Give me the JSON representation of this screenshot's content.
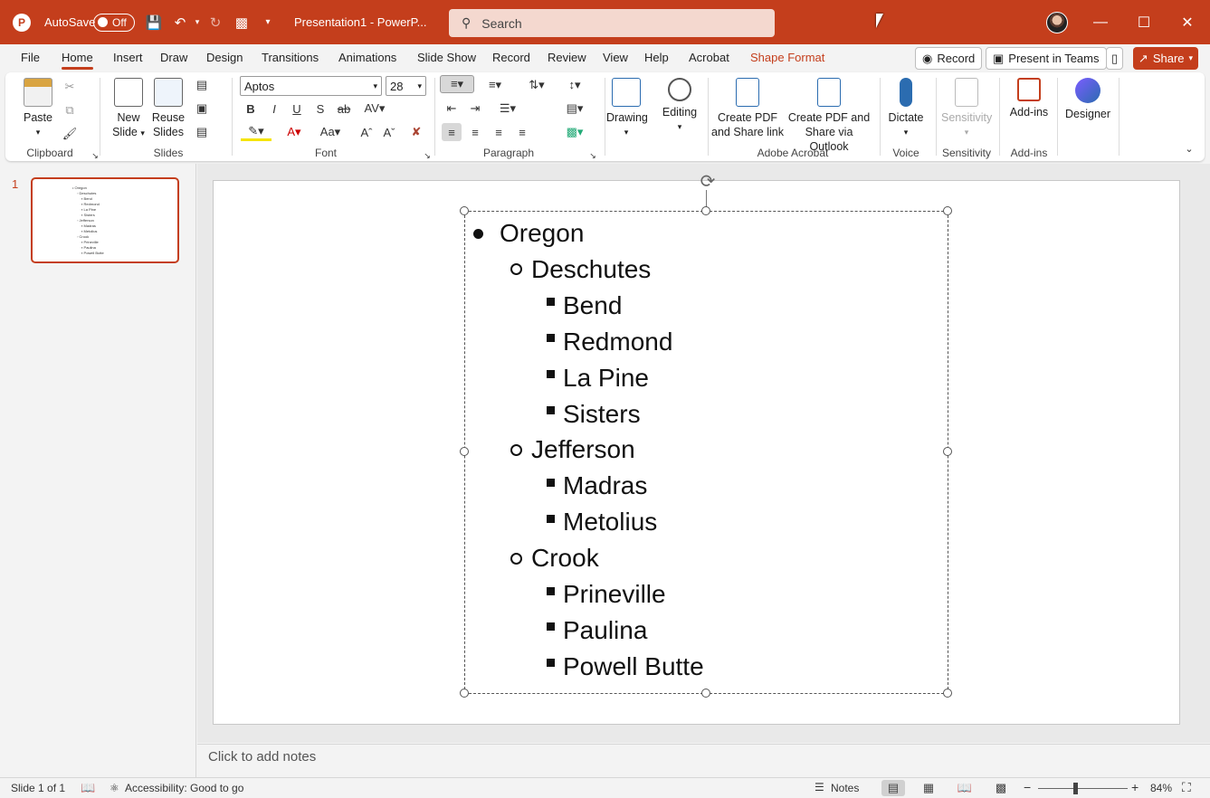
{
  "window": {
    "autosave_label": "AutoSave",
    "autosave_state": "Off",
    "doc_title": "Presentation1  -  PowerP...",
    "search_placeholder": "Search",
    "accent_color": "#c43e1c"
  },
  "tabs": [
    "File",
    "Home",
    "Insert",
    "Draw",
    "Design",
    "Transitions",
    "Animations",
    "Slide Show",
    "Record",
    "Review",
    "View",
    "Help",
    "Acrobat",
    "Shape Format"
  ],
  "active_tab": "Home",
  "tab_buttons": {
    "record": "Record",
    "present_teams": "Present in Teams",
    "share": "Share"
  },
  "ribbon": {
    "clipboard": {
      "paste": "Paste",
      "label": "Clipboard"
    },
    "slides": {
      "new_slide": "New\nSlide",
      "new_slide_l1": "New",
      "new_slide_l2": "Slide",
      "reuse_l1": "Reuse",
      "reuse_l2": "Slides",
      "label": "Slides"
    },
    "font": {
      "name": "Aptos",
      "size": "28",
      "label": "Font"
    },
    "paragraph": {
      "label": "Paragraph"
    },
    "drawing": {
      "label": "Drawing"
    },
    "editing": {
      "label": "Editing"
    },
    "acrobat": {
      "create_pdf_l1": "Create PDF",
      "create_pdf_l2": "and Share link",
      "create_outlook_l1": "Create PDF and",
      "create_outlook_l2": "Share via Outlook",
      "label": "Adobe Acrobat"
    },
    "voice": {
      "dictate": "Dictate",
      "label": "Voice"
    },
    "sensitivity": {
      "button": "Sensitivity",
      "label": "Sensitivity"
    },
    "addins": {
      "button": "Add-ins",
      "label": "Add-ins"
    },
    "designer": {
      "button": "Designer"
    }
  },
  "slide_panel": {
    "slide_number": "1"
  },
  "slide": {
    "lines": [
      {
        "level": 1,
        "text": "Oregon"
      },
      {
        "level": 2,
        "text": "Deschutes"
      },
      {
        "level": 3,
        "text": "Bend"
      },
      {
        "level": 3,
        "text": "Redmond"
      },
      {
        "level": 3,
        "text": "La Pine"
      },
      {
        "level": 3,
        "text": "Sisters"
      },
      {
        "level": 2,
        "text": "Jefferson"
      },
      {
        "level": 3,
        "text": "Madras"
      },
      {
        "level": 3,
        "text": "Metolius"
      },
      {
        "level": 2,
        "text": "Crook"
      },
      {
        "level": 3,
        "text": "Prineville"
      },
      {
        "level": 3,
        "text": "Paulina"
      },
      {
        "level": 3,
        "text": "Powell Butte"
      }
    ]
  },
  "notes": {
    "placeholder": "Click to add notes"
  },
  "status": {
    "slide_info": "Slide 1 of 1",
    "accessibility": "Accessibility: Good to go",
    "notes": "Notes",
    "zoom": "84%"
  }
}
